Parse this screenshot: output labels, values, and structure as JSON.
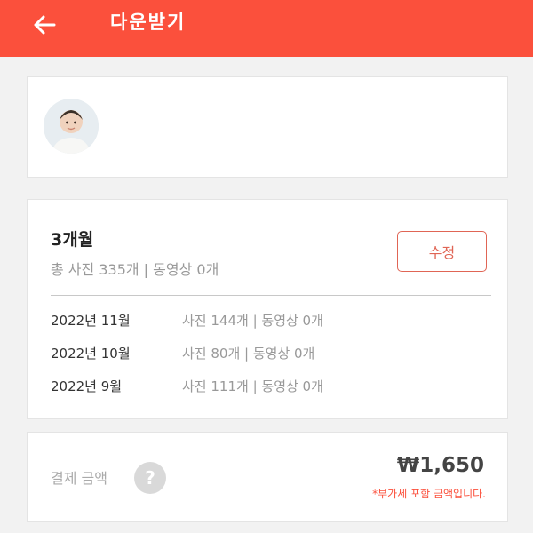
{
  "header": {
    "title": "다운받기",
    "background": "#fb503c",
    "back_icon": "arrow-left-icon"
  },
  "profile": {
    "avatar": "child-photo"
  },
  "period": {
    "title": "3개월",
    "summary": "총 사진 335개 | 동영상 0개",
    "edit_label": "수정",
    "months": [
      {
        "label": "2022년 11월",
        "stats": "사진 144개 | 동영상 0개"
      },
      {
        "label": "2022년 10월",
        "stats": "사진 80개 | 동영상 0개"
      },
      {
        "label": "2022년 9월",
        "stats": "사진 111개 | 동영상 0개"
      }
    ]
  },
  "payment": {
    "label": "결제 금액",
    "help_icon": "question-icon",
    "help_glyph": "?",
    "amount": "₩1,650",
    "note": "*부가세 포함 금액입니다."
  }
}
